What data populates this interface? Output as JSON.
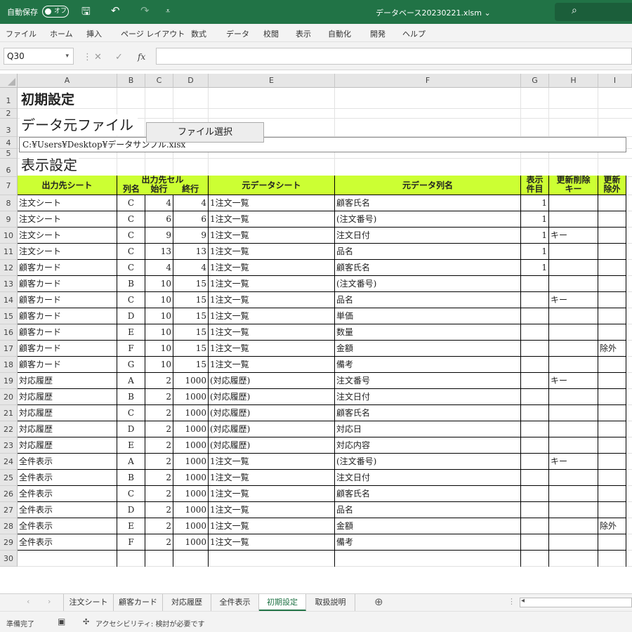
{
  "titlebar": {
    "autosave_label": "自動保存",
    "autosave_state": "オフ",
    "document_title": "データベース20230221.xlsm ⌄"
  },
  "menu": [
    "ファイル",
    "ホーム",
    "挿入",
    "ページ レイアウト",
    "数式",
    "データ",
    "校閲",
    "表示",
    "自動化",
    "開発",
    "ヘルプ"
  ],
  "formula_bar": {
    "name_box": "Q30",
    "formula": ""
  },
  "columns": [
    "A",
    "B",
    "C",
    "D",
    "E",
    "F",
    "G",
    "H",
    "I"
  ],
  "row_numbers": [
    "1",
    "2",
    "3",
    "4",
    "5",
    "6",
    "7",
    "8",
    "9",
    "10",
    "11",
    "12",
    "13",
    "14",
    "15",
    "16",
    "17",
    "18",
    "19",
    "20",
    "21",
    "22",
    "23",
    "24",
    "25",
    "26",
    "27",
    "28",
    "29",
    "30"
  ],
  "sheet": {
    "heading": "初期設定",
    "source_heading": "データ元ファイル",
    "file_button": "ファイル選択",
    "file_path": "C:¥Users¥Desktop¥データサンプル.xlsx",
    "display_heading": "表示設定",
    "table_headers": {
      "output_sheet": "出力先シート",
      "output_cell": "出力先セル",
      "col_name": "列名",
      "start_row": "始行",
      "end_row": "終行",
      "source_sheet": "元データシート",
      "source_column": "元データ列名",
      "display_count_1": "表示",
      "display_count_2": "件目",
      "update_delete_key_1": "更新削除",
      "update_delete_key_2": "キー",
      "update_exclude_1": "更新",
      "update_exclude_2": "除外"
    },
    "rows": [
      [
        "注文シート",
        "C",
        "4",
        "4",
        "1注文一覧",
        "顧客氏名",
        "1",
        "",
        ""
      ],
      [
        "注文シート",
        "C",
        "6",
        "6",
        "1注文一覧",
        "(注文番号)",
        "1",
        "",
        ""
      ],
      [
        "注文シート",
        "C",
        "9",
        "9",
        "1注文一覧",
        "注文日付",
        "1",
        "キー",
        ""
      ],
      [
        "注文シート",
        "C",
        "13",
        "13",
        "1注文一覧",
        "品名",
        "1",
        "",
        ""
      ],
      [
        "顧客カード",
        "C",
        "4",
        "4",
        "1注文一覧",
        "顧客氏名",
        "1",
        "",
        ""
      ],
      [
        "顧客カード",
        "B",
        "10",
        "15",
        "1注文一覧",
        "(注文番号)",
        "",
        "",
        ""
      ],
      [
        "顧客カード",
        "C",
        "10",
        "15",
        "1注文一覧",
        "品名",
        "",
        "キー",
        ""
      ],
      [
        "顧客カード",
        "D",
        "10",
        "15",
        "1注文一覧",
        "単価",
        "",
        "",
        ""
      ],
      [
        "顧客カード",
        "E",
        "10",
        "15",
        "1注文一覧",
        "数量",
        "",
        "",
        ""
      ],
      [
        "顧客カード",
        "F",
        "10",
        "15",
        "1注文一覧",
        "金額",
        "",
        "",
        "除外"
      ],
      [
        "顧客カード",
        "G",
        "10",
        "15",
        "1注文一覧",
        "備考",
        "",
        "",
        ""
      ],
      [
        "対応履歴",
        "A",
        "2",
        "1000",
        "(対応履歴)",
        "注文番号",
        "",
        "キー",
        ""
      ],
      [
        "対応履歴",
        "B",
        "2",
        "1000",
        "(対応履歴)",
        "注文日付",
        "",
        "",
        ""
      ],
      [
        "対応履歴",
        "C",
        "2",
        "1000",
        "(対応履歴)",
        "顧客氏名",
        "",
        "",
        ""
      ],
      [
        "対応履歴",
        "D",
        "2",
        "1000",
        "(対応履歴)",
        "対応日",
        "",
        "",
        ""
      ],
      [
        "対応履歴",
        "E",
        "2",
        "1000",
        "(対応履歴)",
        "対応内容",
        "",
        "",
        ""
      ],
      [
        "全件表示",
        "A",
        "2",
        "1000",
        "1注文一覧",
        "(注文番号)",
        "",
        "キー",
        ""
      ],
      [
        "全件表示",
        "B",
        "2",
        "1000",
        "1注文一覧",
        "注文日付",
        "",
        "",
        ""
      ],
      [
        "全件表示",
        "C",
        "2",
        "1000",
        "1注文一覧",
        "顧客氏名",
        "",
        "",
        ""
      ],
      [
        "全件表示",
        "D",
        "2",
        "1000",
        "1注文一覧",
        "品名",
        "",
        "",
        ""
      ],
      [
        "全件表示",
        "E",
        "2",
        "1000",
        "1注文一覧",
        "金額",
        "",
        "",
        "除外"
      ],
      [
        "全件表示",
        "F",
        "2",
        "1000",
        "1注文一覧",
        "備考",
        "",
        "",
        ""
      ]
    ]
  },
  "sheet_tabs": [
    "注文シート",
    "顧客カード",
    "対応履歴",
    "全件表示",
    "初期設定",
    "取扱説明"
  ],
  "active_tab": "初期設定",
  "status": {
    "ready": "準備完了",
    "accessibility": "アクセシビリティ: 検討が必要です"
  },
  "colors": {
    "excel_green": "#217346",
    "header_fill": "#ccff33"
  }
}
